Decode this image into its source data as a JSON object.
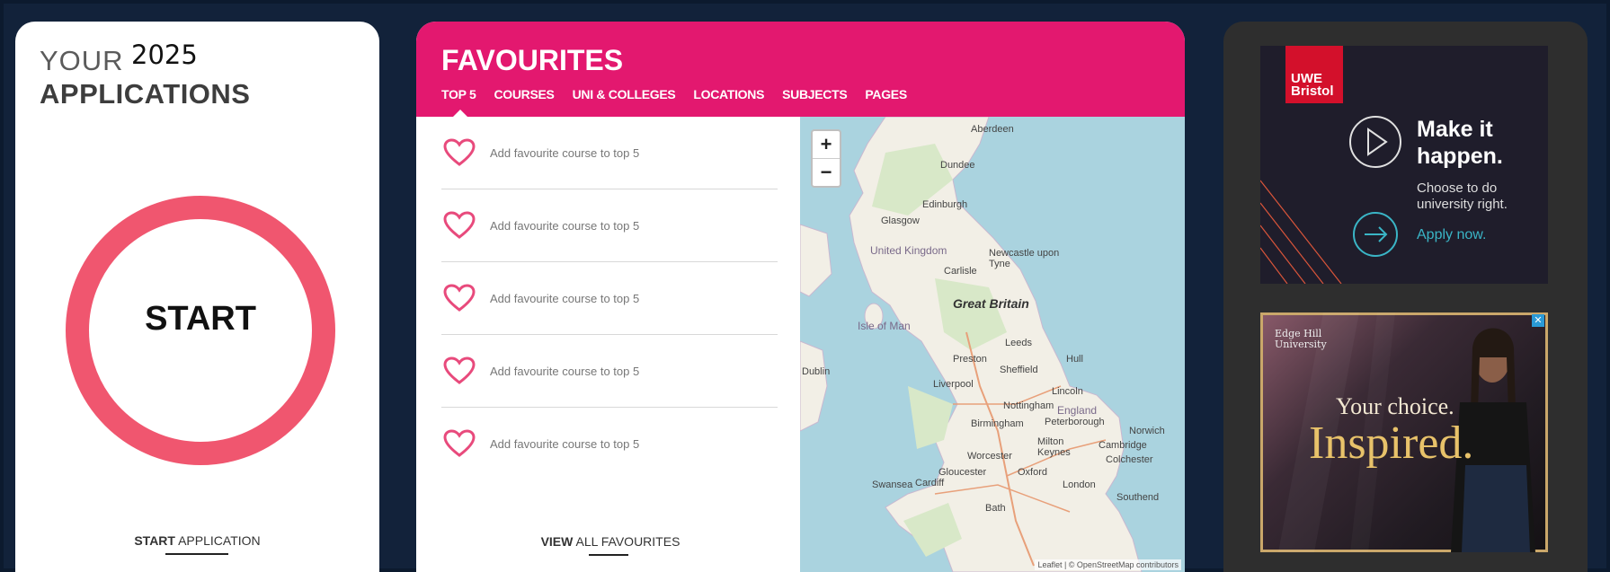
{
  "applications": {
    "your": "YOUR",
    "year": "2025",
    "title": "APPLICATIONS",
    "start_label": "START",
    "footer_bold": "START",
    "footer_rest": "APPLICATION"
  },
  "favourites": {
    "title": "FAVOURITES",
    "tabs": [
      "TOP 5",
      "COURSES",
      "UNI & COLLEGES",
      "LOCATIONS",
      "SUBJECTS",
      "PAGES"
    ],
    "items": [
      "Add favourite course to top 5",
      "Add favourite course to top 5",
      "Add favourite course to top 5",
      "Add favourite course to top 5",
      "Add favourite course to top 5"
    ],
    "footer_bold": "VIEW",
    "footer_rest": "ALL FAVOURITES"
  },
  "map": {
    "zoom_in": "+",
    "zoom_out": "−",
    "labels": {
      "aberdeen": "Aberdeen",
      "dundee": "Dundee",
      "edinburgh": "Edinburgh",
      "glasgow": "Glasgow",
      "united_kingdom": "United Kingdom",
      "newcastle": "Newcastle upon Tyne",
      "carlisle": "Carlisle",
      "great_britain": "Great Britain",
      "isle_of_man": "Isle of Man",
      "leeds": "Leeds",
      "preston": "Preston",
      "hull": "Hull",
      "dublin": "Dublin",
      "sheffield": "Sheffield",
      "liverpool": "Liverpool",
      "lincoln": "Lincoln",
      "nottingham": "Nottingham",
      "england": "England",
      "birmingham": "Birmingham",
      "peterborough": "Peterborough",
      "norwich": "Norwich",
      "milton_keynes": "Milton Keynes",
      "cambridge": "Cambridge",
      "worcester": "Worcester",
      "colchester": "Colchester",
      "gloucester": "Gloucester",
      "oxford": "Oxford",
      "swansea": "Swansea",
      "cardiff": "Cardiff",
      "london": "London",
      "southend": "Southend",
      "bath": "Bath"
    },
    "attribution": "Leaflet | © OpenStreetMap contributors"
  },
  "ads": {
    "uwe_logo_line1": "UWE",
    "uwe_logo_line2": "Bristol",
    "uwe_headline": "Make it happen.",
    "uwe_sub": "Choose to do university right.",
    "uwe_cta": "Apply now.",
    "edge_logo_line1": "Edge Hill",
    "edge_logo_line2": "University",
    "edge_line1": "Your choice.",
    "edge_line2": "Inspired.",
    "close": "✕"
  },
  "colors": {
    "favourites_header": "#e3186f",
    "start_ring": "#f0566f",
    "heart": "#e84a7c",
    "uwe_red": "#d3102b",
    "uwe_teal": "#3ab5c6",
    "edge_gold": "#e8c26a"
  }
}
